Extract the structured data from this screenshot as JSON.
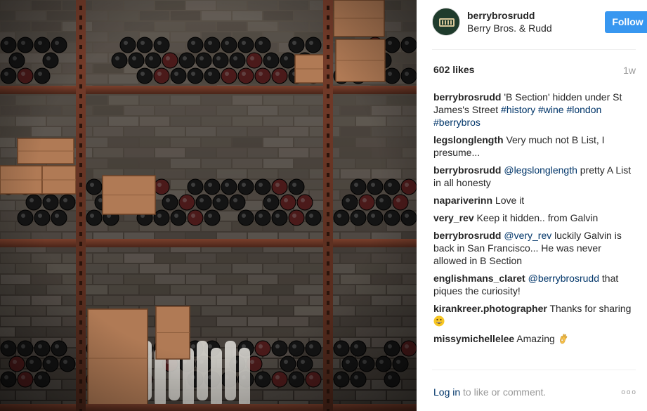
{
  "photo": {
    "alt_name": "wine-cellar-photo"
  },
  "post": {
    "username": "berrybrosrudd",
    "fullname": "Berry Bros. & Rudd",
    "follow_label": "Follow",
    "likes": "602 likes",
    "time_ago": "1w"
  },
  "comments": [
    {
      "user": "berrybrosrudd",
      "parts": [
        {
          "t": "text",
          "v": " 'B Section' hidden under St James's Street "
        },
        {
          "t": "tag",
          "v": "#history"
        },
        {
          "t": "text",
          "v": " "
        },
        {
          "t": "tag",
          "v": "#wine"
        },
        {
          "t": "text",
          "v": " "
        },
        {
          "t": "tag",
          "v": "#london"
        },
        {
          "t": "text",
          "v": " "
        },
        {
          "t": "tag",
          "v": "#berrybros"
        }
      ]
    },
    {
      "user": "legslonglength",
      "parts": [
        {
          "t": "text",
          "v": " Very much not B List, I presume..."
        }
      ]
    },
    {
      "user": "berrybrosrudd",
      "parts": [
        {
          "t": "text",
          "v": " "
        },
        {
          "t": "tag",
          "v": "@legslonglength"
        },
        {
          "t": "text",
          "v": " pretty A List in all honesty"
        }
      ]
    },
    {
      "user": "napariverinn",
      "parts": [
        {
          "t": "text",
          "v": " Love it"
        }
      ]
    },
    {
      "user": "very_rev",
      "parts": [
        {
          "t": "text",
          "v": " Keep it hidden.. from Galvin"
        }
      ]
    },
    {
      "user": "berrybrosrudd",
      "parts": [
        {
          "t": "text",
          "v": " "
        },
        {
          "t": "tag",
          "v": "@very_rev"
        },
        {
          "t": "text",
          "v": " luckily Galvin is back in San Francisco... He was never allowed in B Section"
        }
      ]
    },
    {
      "user": "englishmans_claret",
      "parts": [
        {
          "t": "text",
          "v": " "
        },
        {
          "t": "tag",
          "v": "@berrybrosrudd"
        },
        {
          "t": "text",
          "v": " that piques the curiosity!"
        }
      ]
    },
    {
      "user": "kirankreer.photographer",
      "parts": [
        {
          "t": "text",
          "v": " Thanks for sharing "
        },
        {
          "t": "emoji",
          "v": "grinning-face-emoji"
        }
      ]
    },
    {
      "user": "missymichellelee",
      "parts": [
        {
          "t": "text",
          "v": " Amazing "
        },
        {
          "t": "emoji",
          "v": "ok-hand-emoji"
        }
      ]
    }
  ],
  "footer": {
    "login_label": "Log in",
    "rest_label": " to like or comment.",
    "more_label": "ooo"
  },
  "colors": {
    "follow": "#3897f0",
    "link": "#003569",
    "muted": "#999999"
  }
}
